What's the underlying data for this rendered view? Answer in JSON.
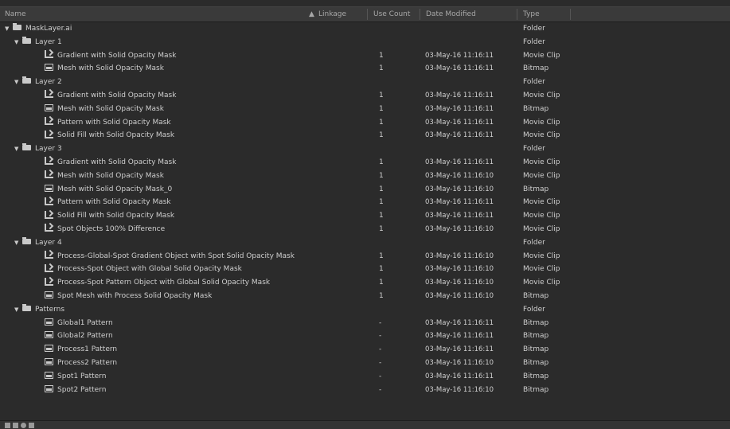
{
  "header": {
    "name": "Name",
    "linkage": "Linkage",
    "use_count": "Use Count",
    "date_modified": "Date Modified",
    "type": "Type"
  },
  "rows": [
    {
      "name": "MaskLayer.ai",
      "level": 0,
      "icon": "folder-icon",
      "use": "",
      "date": "",
      "type": "Folder"
    },
    {
      "name": "Layer 1",
      "level": 1,
      "icon": "folder-icon",
      "use": "",
      "date": "",
      "type": "Folder"
    },
    {
      "name": "Gradient with Solid Opacity Mask",
      "level": 2,
      "icon": "movie-clip-icon",
      "use": "1",
      "date": "03-May-16 11:16:11",
      "type": "Movie Clip"
    },
    {
      "name": "Mesh with Solid Opacity Mask",
      "level": 2,
      "icon": "bitmap-icon",
      "use": "1",
      "date": "03-May-16 11:16:11",
      "type": "Bitmap"
    },
    {
      "name": "Layer 2",
      "level": 1,
      "icon": "folder-icon",
      "use": "",
      "date": "",
      "type": "Folder"
    },
    {
      "name": "Gradient with Solid Opacity Mask",
      "level": 2,
      "icon": "movie-clip-icon",
      "use": "1",
      "date": "03-May-16 11:16:11",
      "type": "Movie Clip"
    },
    {
      "name": "Mesh with Solid Opacity Mask",
      "level": 2,
      "icon": "bitmap-icon",
      "use": "1",
      "date": "03-May-16 11:16:11",
      "type": "Bitmap"
    },
    {
      "name": "Pattern with Solid Opacity Mask",
      "level": 2,
      "icon": "movie-clip-icon",
      "use": "1",
      "date": "03-May-16 11:16:11",
      "type": "Movie Clip"
    },
    {
      "name": "Solid Fill with Solid Opacity Mask",
      "level": 2,
      "icon": "movie-clip-icon",
      "use": "1",
      "date": "03-May-16 11:16:11",
      "type": "Movie Clip"
    },
    {
      "name": "Layer 3",
      "level": 1,
      "icon": "folder-icon",
      "use": "",
      "date": "",
      "type": "Folder"
    },
    {
      "name": "Gradient with Solid Opacity Mask",
      "level": 2,
      "icon": "movie-clip-icon",
      "use": "1",
      "date": "03-May-16 11:16:11",
      "type": "Movie Clip"
    },
    {
      "name": "Mesh with Solid Opacity Mask",
      "level": 2,
      "icon": "movie-clip-icon",
      "use": "1",
      "date": "03-May-16 11:16:10",
      "type": "Movie Clip"
    },
    {
      "name": "Mesh with Solid Opacity Mask_0",
      "level": 2,
      "icon": "bitmap-icon",
      "use": "1",
      "date": "03-May-16 11:16:10",
      "type": "Bitmap"
    },
    {
      "name": "Pattern with Solid Opacity Mask",
      "level": 2,
      "icon": "movie-clip-icon",
      "use": "1",
      "date": "03-May-16 11:16:11",
      "type": "Movie Clip"
    },
    {
      "name": "Solid Fill with Solid Opacity Mask",
      "level": 2,
      "icon": "movie-clip-icon",
      "use": "1",
      "date": "03-May-16 11:16:11",
      "type": "Movie Clip"
    },
    {
      "name": "Spot Objects 100% Difference",
      "level": 2,
      "icon": "movie-clip-icon",
      "use": "1",
      "date": "03-May-16 11:16:10",
      "type": "Movie Clip"
    },
    {
      "name": "Layer 4",
      "level": 1,
      "icon": "folder-icon",
      "use": "",
      "date": "",
      "type": "Folder"
    },
    {
      "name": "Process-Global-Spot Gradient Object with Spot Solid Opacity Mask",
      "level": 2,
      "icon": "movie-clip-icon",
      "use": "1",
      "date": "03-May-16 11:16:10",
      "type": "Movie Clip"
    },
    {
      "name": "Process-Spot Object with Global Solid Opacity Mask",
      "level": 2,
      "icon": "movie-clip-icon",
      "use": "1",
      "date": "03-May-16 11:16:10",
      "type": "Movie Clip"
    },
    {
      "name": "Process-Spot Pattern Object with Global Solid Opacity Mask",
      "level": 2,
      "icon": "movie-clip-icon",
      "use": "1",
      "date": "03-May-16 11:16:10",
      "type": "Movie Clip"
    },
    {
      "name": "Spot Mesh with Process Solid Opacity Mask",
      "level": 2,
      "icon": "bitmap-icon",
      "use": "1",
      "date": "03-May-16 11:16:10",
      "type": "Bitmap"
    },
    {
      "name": "Patterns",
      "level": 1,
      "icon": "folder-icon",
      "use": "",
      "date": "",
      "type": "Folder"
    },
    {
      "name": "Global1 Pattern",
      "level": 2,
      "icon": "bitmap-icon",
      "use": "-",
      "date": "03-May-16 11:16:11",
      "type": "Bitmap"
    },
    {
      "name": "Global2 Pattern",
      "level": 2,
      "icon": "bitmap-icon",
      "use": "-",
      "date": "03-May-16 11:16:11",
      "type": "Bitmap"
    },
    {
      "name": "Process1 Pattern",
      "level": 2,
      "icon": "bitmap-icon",
      "use": "-",
      "date": "03-May-16 11:16:11",
      "type": "Bitmap"
    },
    {
      "name": "Process2 Pattern",
      "level": 2,
      "icon": "bitmap-icon",
      "use": "-",
      "date": "03-May-16 11:16:10",
      "type": "Bitmap"
    },
    {
      "name": "Spot1 Pattern",
      "level": 2,
      "icon": "bitmap-icon",
      "use": "-",
      "date": "03-May-16 11:16:11",
      "type": "Bitmap"
    },
    {
      "name": "Spot2 Pattern",
      "level": 2,
      "icon": "bitmap-icon",
      "use": "-",
      "date": "03-May-16 11:16:10",
      "type": "Bitmap"
    }
  ],
  "footer": {
    "icons": [
      "new-symbol-icon",
      "new-folder-icon",
      "properties-icon",
      "delete-icon"
    ]
  }
}
